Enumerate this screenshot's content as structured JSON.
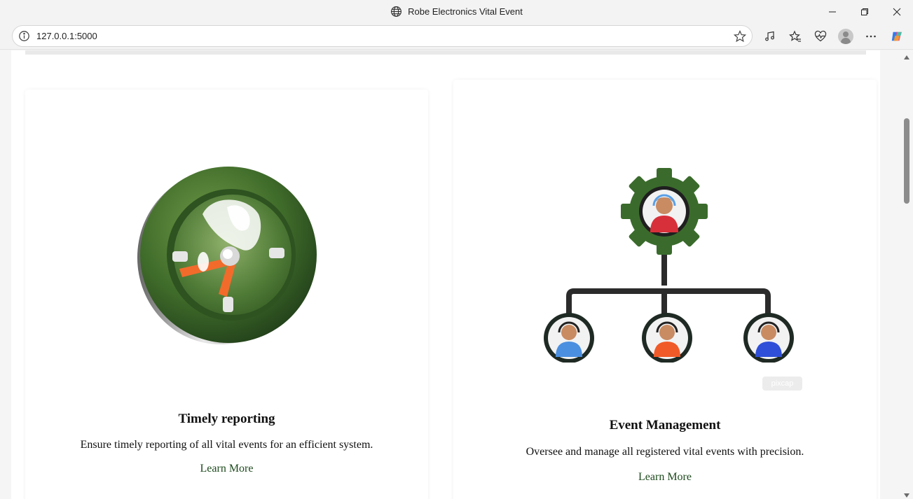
{
  "window": {
    "title": "Robe Electronics Vital Event",
    "icons": [
      "globe-icon",
      "minimize-icon",
      "restore-icon",
      "close-icon"
    ]
  },
  "toolbar": {
    "url": "127.0.0.1:5000",
    "icons": [
      "site-info-icon",
      "favorite-star-icon",
      "media-control-icon",
      "favorites-icon",
      "browser-essentials-icon",
      "profile-avatar",
      "more-menu-icon",
      "copilot-icon"
    ]
  },
  "cards": [
    {
      "illustration": "clock-icon",
      "title": "Timely reporting",
      "text": "Ensure timely reporting of all vital events for an efficient system.",
      "link": "Learn More"
    },
    {
      "illustration": "team-hierarchy-icon",
      "watermark": "pixcap",
      "title": "Event Management",
      "text": "Oversee and manage all registered vital events with precision.",
      "link": "Learn More"
    }
  ],
  "colors": {
    "accent_green": "#3f6b2a",
    "link_green": "#1d4a1d",
    "orange": "#f26b2b"
  }
}
